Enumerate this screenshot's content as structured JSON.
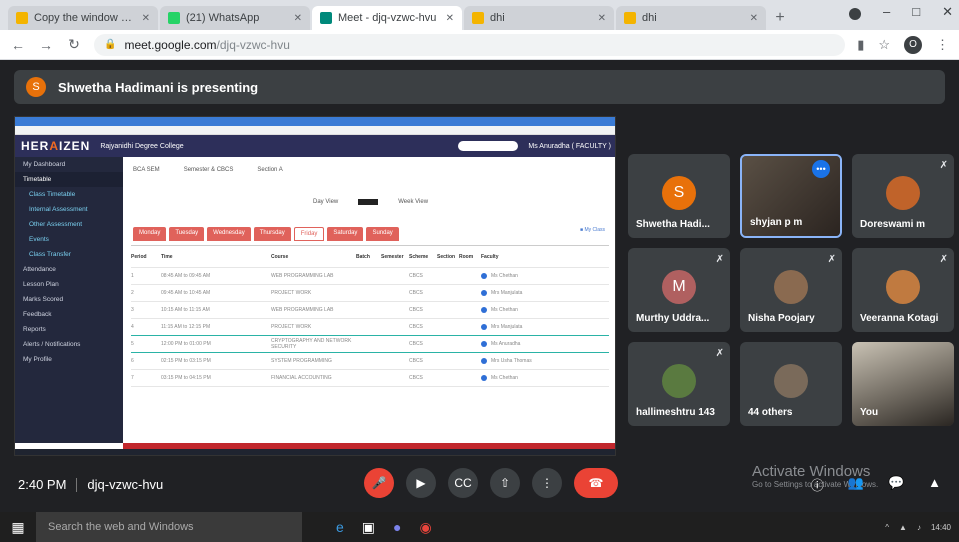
{
  "browser": {
    "tabs": [
      {
        "title": "Copy the window or scree",
        "color": "#f4b400",
        "active": false
      },
      {
        "title": "(21) WhatsApp",
        "color": "#25d366",
        "active": false
      },
      {
        "title": "Meet - djq-vzwc-hvu",
        "color": "#00897b",
        "active": true
      },
      {
        "title": "dhi",
        "color": "#f4b400",
        "active": false
      },
      {
        "title": "dhi",
        "color": "#f4b400",
        "active": false
      }
    ],
    "url_host": "meet.google.com",
    "url_path": "/djq-vzwc-hvu",
    "profile_initial": "O"
  },
  "presenting_banner": {
    "initial": "S",
    "text": "Shwetha Hadimani is presenting"
  },
  "shared_screen": {
    "logo_a": "HER",
    "logo_b": "A",
    "logo_c": "IZEN",
    "college": "Rajyanidhi Degree College",
    "user": "Ms Anuradha ( FACULTY )",
    "sidebar": [
      {
        "label": "My Dashboard",
        "cls": ""
      },
      {
        "label": "Timetable",
        "cls": "act"
      },
      {
        "label": "Class Timetable",
        "cls": "sub"
      },
      {
        "label": "Internal Assessment",
        "cls": "sub"
      },
      {
        "label": "Other Assessment",
        "cls": "sub"
      },
      {
        "label": "Events",
        "cls": "sub"
      },
      {
        "label": "Class Transfer",
        "cls": "sub"
      },
      {
        "label": "Attendance",
        "cls": ""
      },
      {
        "label": "Lesson Plan",
        "cls": ""
      },
      {
        "label": "Marks Scored",
        "cls": ""
      },
      {
        "label": "Feedback",
        "cls": ""
      },
      {
        "label": "Reports",
        "cls": ""
      },
      {
        "label": "Alerts / Notifications",
        "cls": ""
      },
      {
        "label": "My Profile",
        "cls": ""
      }
    ],
    "filters": [
      "BCA SEM",
      "Semester & CBCS",
      "Section A"
    ],
    "day_view": "Day View",
    "week_view": "Week View",
    "days": [
      "Monday",
      "Tuesday",
      "Wednesday",
      "Thursday",
      "Friday",
      "Saturday",
      "Sunday"
    ],
    "active_day": "Friday",
    "legend": "My Class",
    "table_header": [
      "Period",
      "Time",
      "Course",
      "Batch",
      "Semester",
      "Scheme",
      "Section",
      "Room",
      "Faculty"
    ],
    "table_rows": [
      {
        "period": "1",
        "time": "08:45 AM to 09:45 AM",
        "course": "WEB PROGRAMMING LAB",
        "scheme": "CBCS",
        "faculty": "Ms Chethan",
        "teal": false
      },
      {
        "period": "2",
        "time": "09:45 AM to 10:45 AM",
        "course": "PROJECT WORK",
        "scheme": "CBCS",
        "faculty": "Mrs Manjulata",
        "teal": false
      },
      {
        "period": "3",
        "time": "10:15 AM to 11:15 AM",
        "course": "WEB PROGRAMMING LAB",
        "scheme": "CBCS",
        "faculty": "Ms Chethan",
        "teal": false
      },
      {
        "period": "4",
        "time": "11:15 AM to 12:15 PM",
        "course": "PROJECT WORK",
        "scheme": "CBCS",
        "faculty": "Mrs Manjulata",
        "teal": true
      },
      {
        "period": "5",
        "time": "12:00 PM to 01:00 PM",
        "course": "CRYPTOGRAPHY AND NETWORK SECURITY",
        "scheme": "CBCS",
        "faculty": "Ms Anuradha",
        "teal": true
      },
      {
        "period": "6",
        "time": "02:15 PM to 03:15 PM",
        "course": "SYSTEM PROGRAMMING",
        "scheme": "CBCS",
        "faculty": "Mrs Usha Thomas",
        "teal": false
      },
      {
        "period": "7",
        "time": "03:15 PM to 04:15 PM",
        "course": "FINANCIAL ACCOUNTING",
        "scheme": "CBCS",
        "faculty": "Ms Chethan",
        "teal": false
      }
    ]
  },
  "participants": [
    {
      "name": "Shwetha Hadi...",
      "initial": "S",
      "color": "#e8710a",
      "muted": false,
      "type": "avatar",
      "selected": false
    },
    {
      "name": "shyjan p m",
      "initial": "",
      "color": "",
      "muted": false,
      "type": "video",
      "selected": true
    },
    {
      "name": "Doreswami m",
      "initial": "",
      "color": "#c0632a",
      "muted": true,
      "type": "photo",
      "selected": false
    },
    {
      "name": "Murthy Uddra...",
      "initial": "M",
      "color": "#b06060",
      "muted": true,
      "type": "avatar",
      "selected": false
    },
    {
      "name": "Nisha Poojary",
      "initial": "",
      "color": "#8a6a50",
      "muted": true,
      "type": "photo",
      "selected": false
    },
    {
      "name": "Veeranna Kotagi",
      "initial": "",
      "color": "#c07a40",
      "muted": true,
      "type": "photo",
      "selected": false
    },
    {
      "name": "hallimeshtru 143",
      "initial": "",
      "color": "#5a7a40",
      "muted": true,
      "type": "photo",
      "selected": false
    },
    {
      "name": "44 others",
      "initial": "",
      "color": "#7a6a5a",
      "muted": false,
      "type": "group",
      "selected": false
    },
    {
      "name": "You",
      "initial": "",
      "color": "",
      "muted": false,
      "type": "video2",
      "selected": false
    }
  ],
  "meeting_info": {
    "time": "2:40 PM",
    "code": "djq-vzwc-hvu"
  },
  "activate_windows": {
    "title": "Activate Windows",
    "subtitle": "Go to Settings to activate Windows."
  },
  "taskbar": {
    "search_placeholder": "Search the web and Windows",
    "clock": "14:40"
  }
}
